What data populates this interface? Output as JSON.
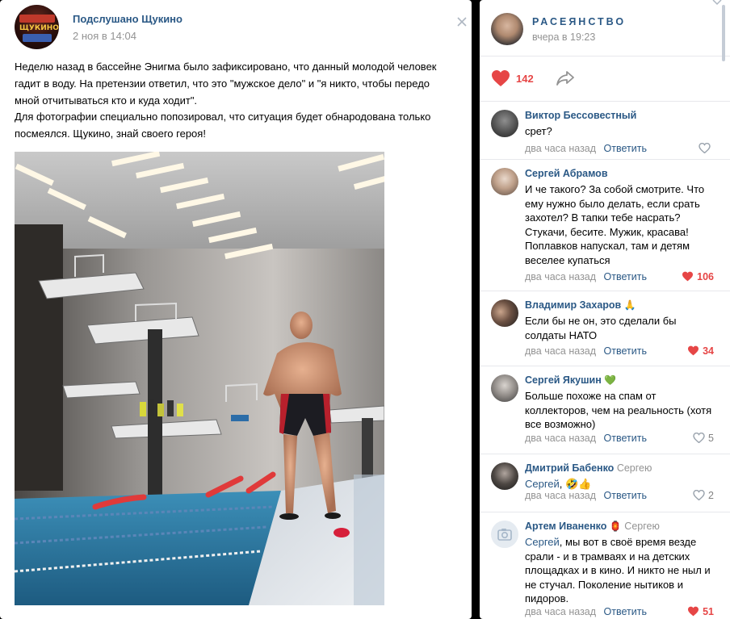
{
  "post": {
    "author": "Подслушано Щукино",
    "date": "2 ноя в 14:04",
    "paragraphs": [
      "Неделю назад в бассейне Энигма было зафиксировано, что данный молодой человек гадит в воду. На претензии ответил, что это \"мужское дело\" и \"я никто, чтобы передо мной отчитываться кто и куда ходит\".",
      "Для фотографии специально попозировал, что ситуация будет обнародована только посмеялся. Щукино, знай своего героя!"
    ],
    "avatar_text": "ЩУКИНО"
  },
  "side": {
    "author": "РАСЕЯНСТВО",
    "date": "вчера в 19:23",
    "likes": "142"
  },
  "comments": [
    {
      "name": "Виктор Бессовестный",
      "reply_to": "",
      "mention": "",
      "text": "срет?",
      "time": "два часа назад",
      "reply_label": "Ответить",
      "likes": "",
      "liked": false
    },
    {
      "name": "Сергей Абрамов",
      "reply_to": "",
      "mention": "",
      "text": "И че такого? За собой смотрите. Что ему нужно было делать, если срать захотел? В тапки тебе насрать? Стукачи, бесите. Мужик, красава! Поплавков напускал, там и детям веселее купаться",
      "time": "два часа назад",
      "reply_label": "Ответить",
      "likes": "106",
      "liked": true
    },
    {
      "name": "Владимир Захаров",
      "name_emoji": "🙏",
      "reply_to": "",
      "mention": "",
      "text": "Если бы не он, это сделали бы солдаты НАТО",
      "time": "два часа назад",
      "reply_label": "Ответить",
      "likes": "34",
      "liked": true
    },
    {
      "name": "Сергей Якушин",
      "name_emoji": "💚",
      "reply_to": "",
      "mention": "",
      "text": "Больше похоже на спам от коллекторов, чем на реальность (хотя все возможно)",
      "time": "два часа назад",
      "reply_label": "Ответить",
      "likes": "5",
      "liked": false
    },
    {
      "name": "Дмитрий Бабенко",
      "reply_to": "Сергею",
      "mention": "Сергей",
      "text": ", 🤣👍",
      "time": "два часа назад",
      "reply_label": "Ответить",
      "likes": "2",
      "liked": false
    },
    {
      "name": "Артем Иваненко",
      "name_emoji": "🏮",
      "reply_to": "Сергею",
      "mention": "Сергей",
      "text": ", мы вот в своё время везде срали - и в трамваях и на детских площадках и в кино. И никто не ныл и не стучал. Поколение нытиков и пидоров.",
      "time": "два часа назад",
      "reply_label": "Ответить",
      "likes": "51",
      "liked": true
    }
  ],
  "colors": {
    "link": "#2a5885",
    "muted": "#939393",
    "like_red": "#e64646",
    "divider": "#e7e8ec",
    "backdrop": "#000000"
  },
  "icons": [
    "more-icon",
    "heart-icon",
    "share-icon",
    "camera-icon"
  ]
}
